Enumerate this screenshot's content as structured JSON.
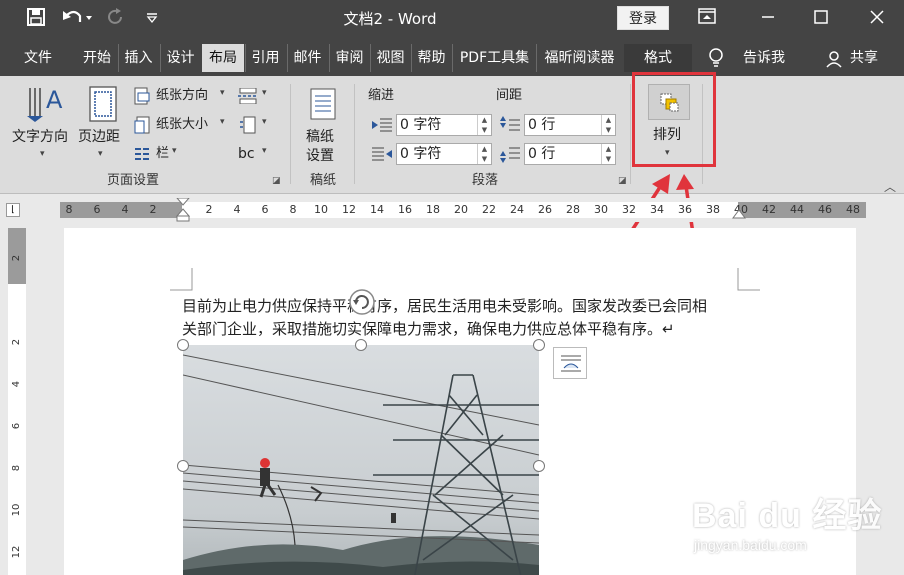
{
  "app": {
    "title": "文档2  -  Word",
    "login": "登录",
    "window_controls": {
      "minimize": "—",
      "restore": "☐",
      "close": "✕"
    },
    "quick_access": {
      "save": "💾",
      "undo": "↶",
      "redo": "↻",
      "customize": "▽"
    }
  },
  "menu": {
    "tabs": [
      {
        "label": "文件"
      },
      {
        "label": "开始"
      },
      {
        "label": "插入"
      },
      {
        "label": "设计"
      },
      {
        "label": "布局",
        "active": true
      },
      {
        "label": "引用"
      },
      {
        "label": "邮件"
      },
      {
        "label": "审阅"
      },
      {
        "label": "视图"
      },
      {
        "label": "帮助"
      },
      {
        "label": "PDF工具集"
      },
      {
        "label": "福昕阅读器"
      },
      {
        "label": "格式"
      }
    ],
    "tell_me": "告诉我",
    "share": "共享"
  },
  "ribbon": {
    "page_setup": {
      "label": "页面设置",
      "text_direction": "文字方向",
      "margins": "页边距",
      "orientation": "纸张方向",
      "size": "纸张大小",
      "columns": "栏",
      "hyphenation": "bc"
    },
    "manuscript": {
      "label": "稿纸",
      "settings_line1": "稿纸",
      "settings_line2": "设置"
    },
    "paragraph": {
      "label": "段落",
      "indent_title": "缩进",
      "spacing_title": "间距",
      "indent_left": "0 字符",
      "indent_right": "0 字符",
      "spacing_before": "0 行",
      "spacing_after": "0 行"
    },
    "arrange": {
      "label": "排列"
    }
  },
  "ruler": {
    "h_ticks": [
      "8",
      "6",
      "4",
      "2",
      "",
      "2",
      "4",
      "6",
      "8",
      "10",
      "12",
      "14",
      "16",
      "18",
      "20",
      "22",
      "24",
      "26",
      "28",
      "30",
      "32",
      "34",
      "36",
      "38",
      "40",
      "42",
      "44",
      "46",
      "48"
    ],
    "v_ticks": [
      "2",
      "",
      "2",
      "4",
      "6",
      "8",
      "10",
      "12"
    ]
  },
  "document": {
    "line1": "目前为止电力供应保持平稳有序，居民生活用电未受影响。国家发改委已会同相",
    "line2": "关部门企业，采取措施切实保障电力需求，确保电力供应总体平稳有序。↵"
  },
  "watermark": {
    "brand": "Bai du 经验",
    "url": "jingyan.baidu.com"
  },
  "colors": {
    "accent": "#e0343c",
    "titlebar": "#444444",
    "ribbon": "#dcdcdc"
  }
}
